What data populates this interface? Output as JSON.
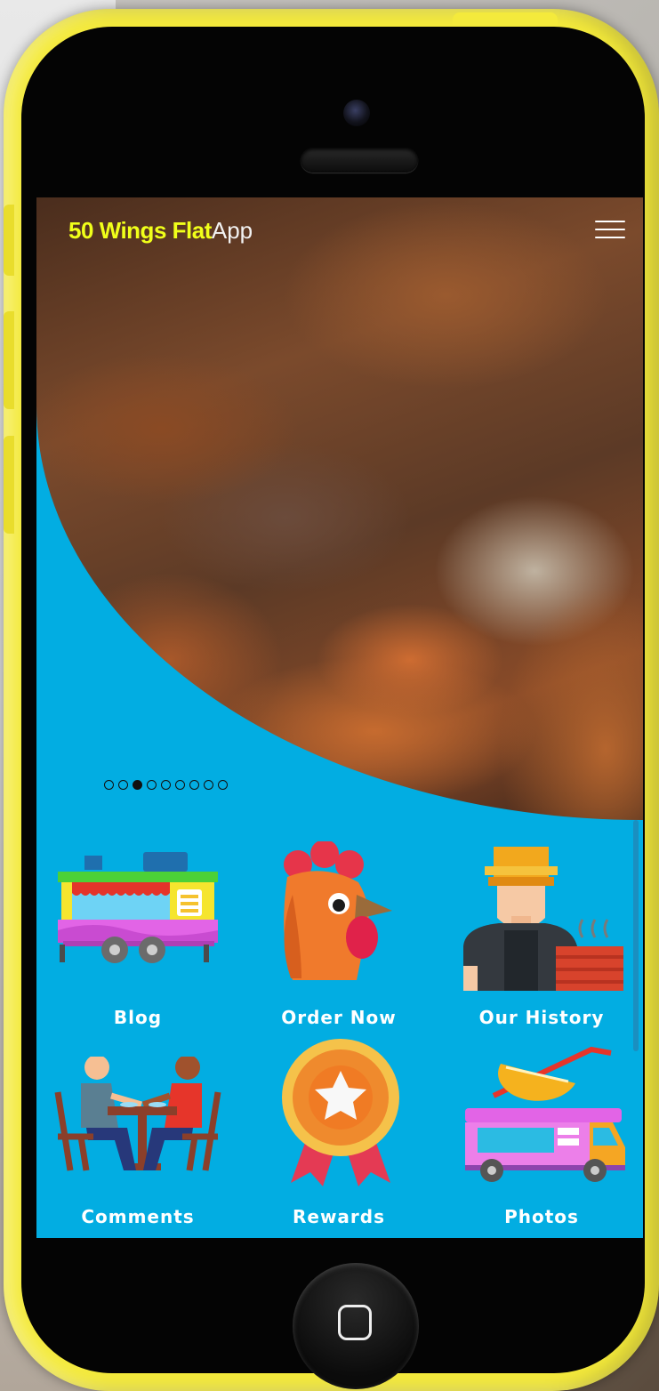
{
  "app": {
    "brand_bold": "50 Wings Flat",
    "brand_light": "App"
  },
  "carousel": {
    "dot_count": 9,
    "active_index": 2
  },
  "menu": [
    {
      "label": "Blog",
      "icon": "food-truck-icon"
    },
    {
      "label": "Order Now",
      "icon": "rooster-icon"
    },
    {
      "label": "Our History",
      "icon": "chef-icon"
    },
    {
      "label": "Comments",
      "icon": "diners-table-icon"
    },
    {
      "label": "Rewards",
      "icon": "star-medal-icon"
    },
    {
      "label": "Photos",
      "icon": "drink-van-icon"
    }
  ],
  "colors": {
    "phone_body": "#f4ea3c",
    "screen_bg": "#02ade2",
    "brand_accent": "#f0ff1a"
  }
}
